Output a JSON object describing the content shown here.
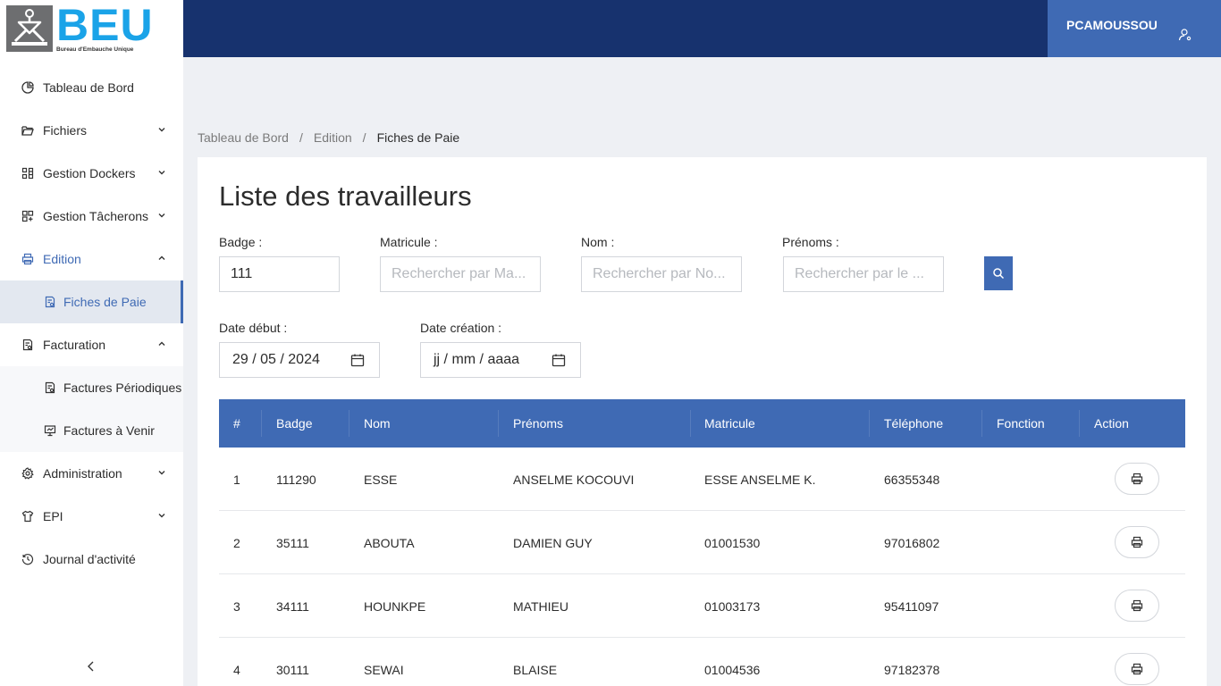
{
  "brand": {
    "name": "BEU",
    "subtitle": "Bureau d'Embauche Unique"
  },
  "user": {
    "name": "PCAMOUSSOU"
  },
  "sidebar": {
    "items": [
      {
        "label": "Tableau de Bord",
        "icon": "pie-chart-icon"
      },
      {
        "label": "Fichiers",
        "icon": "folder-open-icon"
      },
      {
        "label": "Gestion Dockers",
        "icon": "grid-icon"
      },
      {
        "label": "Gestion Tâcherons",
        "icon": "layout-icon"
      },
      {
        "label": "Edition",
        "icon": "printer-icon"
      },
      {
        "label": "Fiches de Paie",
        "icon": "document-icon"
      },
      {
        "label": "Facturation",
        "icon": "invoice-icon"
      },
      {
        "label": "Factures Périodiques",
        "icon": "invoice-icon"
      },
      {
        "label": "Factures à Venir",
        "icon": "presentation-icon"
      },
      {
        "label": "Administration",
        "icon": "gear-icon"
      },
      {
        "label": "EPI",
        "icon": "shirt-icon"
      },
      {
        "label": "Journal d'activité",
        "icon": "history-icon"
      }
    ]
  },
  "breadcrumb": [
    "Tableau de Bord",
    "Edition",
    "Fiches de Paie"
  ],
  "page": {
    "title": "Liste des travailleurs"
  },
  "filters": {
    "badge": {
      "label": "Badge",
      "value": "111"
    },
    "matricule": {
      "label": "Matricule",
      "placeholder": "Rechercher par Ma..."
    },
    "nom": {
      "label": "Nom",
      "placeholder": "Rechercher par No..."
    },
    "prenoms": {
      "label": "Prénoms",
      "placeholder": "Rechercher par le ..."
    },
    "date_debut": {
      "label": "Date début",
      "value": "29 / 05 / 2024"
    },
    "date_creation": {
      "label": "Date création",
      "value": "jj / mm / aaaa"
    }
  },
  "table": {
    "headers": [
      "#",
      "Badge",
      "Nom",
      "Prénoms",
      "Matricule",
      "Téléphone",
      "Fonction",
      "Action"
    ],
    "rows": [
      {
        "num": "1",
        "badge": "111290",
        "nom": "ESSE",
        "prenoms": "ANSELME KOCOUVI",
        "matricule": "ESSE ANSELME K.",
        "telephone": "66355348",
        "fonction": ""
      },
      {
        "num": "2",
        "badge": "35111",
        "nom": "ABOUTA",
        "prenoms": "DAMIEN GUY",
        "matricule": "01001530",
        "telephone": "97016802",
        "fonction": ""
      },
      {
        "num": "3",
        "badge": "34111",
        "nom": "HOUNKPE",
        "prenoms": "MATHIEU",
        "matricule": "01003173",
        "telephone": "95411097",
        "fonction": ""
      },
      {
        "num": "4",
        "badge": "30111",
        "nom": "SEWAI",
        "prenoms": "BLAISE",
        "matricule": "01004536",
        "telephone": "97182378",
        "fonction": ""
      }
    ]
  },
  "colors": {
    "primary": "#3f6ab4",
    "topbar": "#17326e",
    "brand": "#1aa3e8"
  }
}
